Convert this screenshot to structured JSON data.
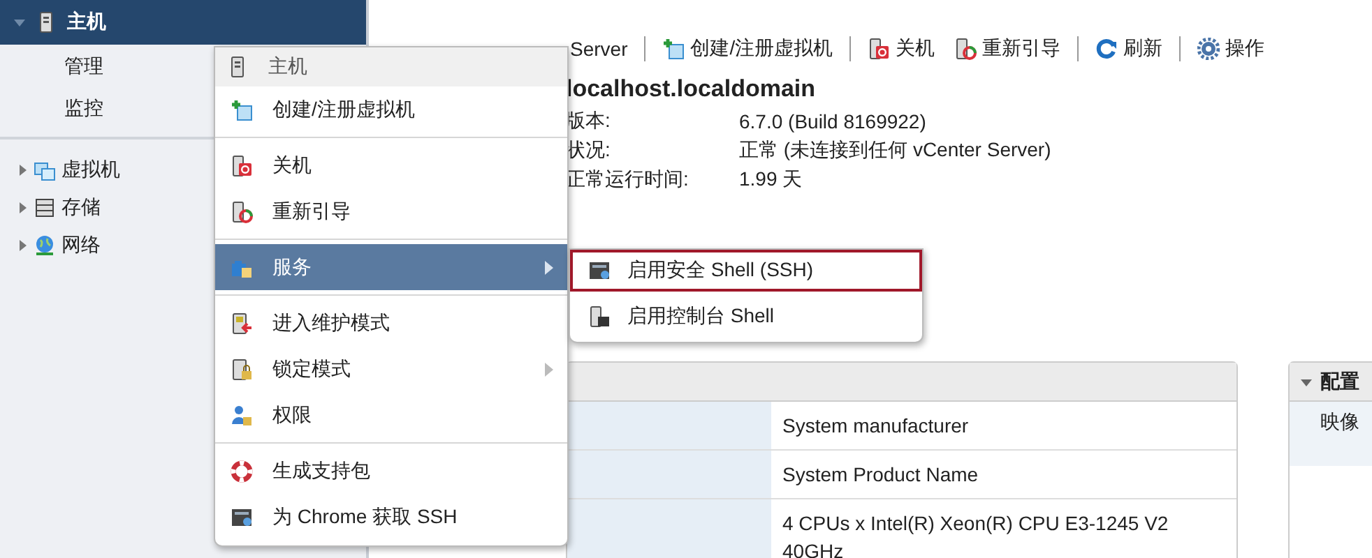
{
  "sidebar": {
    "host": {
      "label": "主机",
      "selected": true,
      "expanded": true
    },
    "host_items": [
      {
        "label": "管理"
      },
      {
        "label": "监控"
      }
    ],
    "tree": [
      {
        "label": "虚拟机",
        "expanded": false
      },
      {
        "label": "存储",
        "expanded": false
      },
      {
        "label": "网络",
        "expanded": false
      }
    ]
  },
  "toolbar": {
    "groups": [
      [
        {
          "label": "Server"
        }
      ],
      [
        {
          "label": "创建/注册虚拟机"
        }
      ],
      [
        {
          "label": "关机"
        },
        {
          "label": "重新引导"
        }
      ],
      [
        {
          "label": "刷新"
        }
      ],
      [
        {
          "label": "操作"
        }
      ]
    ]
  },
  "host_title": "localhost.localdomain",
  "properties": [
    {
      "label": "版本:",
      "value": "6.7.0 (Build 8169922)"
    },
    {
      "label": "状况:",
      "value": "正常 (未连接到任何 vCenter Server)"
    },
    {
      "label": "正常运行时间:",
      "value": "1.99 天"
    }
  ],
  "hardware_table": {
    "rows": [
      {
        "value": [
          "System manufacturer"
        ]
      },
      {
        "value": [
          "System Product Name"
        ]
      },
      {
        "value": [
          "4 CPUs x Intel(R) Xeon(R) CPU E3-1245 V2",
          "40GHz"
        ]
      }
    ]
  },
  "config_panel": {
    "title": "配置",
    "expanded": true,
    "rows": [
      "映像"
    ]
  },
  "context_menu": {
    "title": "主机",
    "groups": [
      [
        {
          "label": "创建/注册虚拟机",
          "selected": false,
          "submenu": false
        }
      ],
      [
        {
          "label": "关机",
          "selected": false,
          "submenu": false
        },
        {
          "label": "重新引导",
          "selected": false,
          "submenu": false
        }
      ],
      [
        {
          "label": "服务",
          "selected": true,
          "submenu": true
        }
      ],
      [
        {
          "label": "进入维护模式",
          "selected": false,
          "submenu": false
        },
        {
          "label": "锁定模式",
          "selected": false,
          "submenu": true
        },
        {
          "label": "权限",
          "selected": false,
          "submenu": false
        }
      ],
      [
        {
          "label": "生成支持包",
          "selected": false,
          "submenu": false
        },
        {
          "label": "为 Chrome 获取 SSH",
          "selected": false,
          "submenu": false
        }
      ]
    ]
  },
  "submenu": {
    "items": [
      {
        "label": "启用安全 Shell (SSH)",
        "selected": true
      },
      {
        "label": "启用控制台 Shell",
        "selected": false
      }
    ]
  }
}
